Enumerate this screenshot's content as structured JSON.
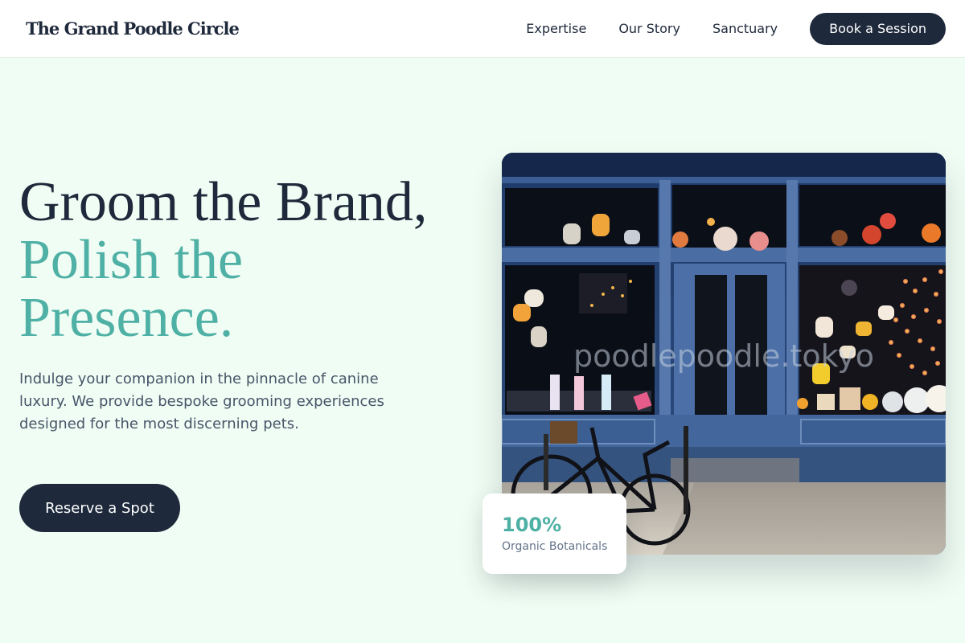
{
  "header": {
    "brand": "The Grand Poodle Circle",
    "nav": [
      {
        "label": "Expertise"
      },
      {
        "label": "Our Story"
      },
      {
        "label": "Sanctuary"
      }
    ],
    "cta_label": "Book a Session"
  },
  "hero": {
    "title_line1": "Groom the Brand,",
    "title_line2": "Polish the",
    "title_line3": "Presence.",
    "description": "Indulge your companion in the pinnacle of canine luxury. We provide bespoke grooming experiences designed for the most discerning pets.",
    "cta_label": "Reserve a Spot"
  },
  "photo": {
    "window_text": "poodlepoodle.tokyo"
  },
  "stat": {
    "value": "100%",
    "label": "Organic Botanicals"
  },
  "colors": {
    "background": "#f0fdf4",
    "dark": "#1e293b",
    "accent": "#4fb0a5"
  }
}
